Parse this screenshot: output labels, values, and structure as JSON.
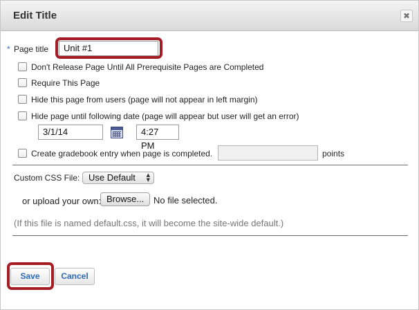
{
  "dialog": {
    "title": "Edit Title",
    "close_glyph": "✖"
  },
  "page_title": {
    "required_marker": "*",
    "label": "Page title",
    "value": "Unit #1"
  },
  "options": [
    {
      "label": "Don't Release Page Until All Prerequisite Pages are Completed",
      "checked": false
    },
    {
      "label": "Require This Page",
      "checked": false
    },
    {
      "label": "Hide this page from users (page will not appear in left margin)",
      "checked": false
    },
    {
      "label": "Hide page until following date (page will appear but user will get an error)",
      "checked": false
    }
  ],
  "release_date": {
    "date": "3/1/14",
    "time": "4:27 PM",
    "calendar_icon": "calendar-icon"
  },
  "gradebook": {
    "label": "Create gradebook entry when page is completed.",
    "value": "",
    "suffix": "points"
  },
  "css": {
    "label": "Custom CSS File:",
    "selected": "Use Default",
    "upload_label": "or upload your own:",
    "browse_label": "Browse...",
    "file_status": "No file selected.",
    "note": "(If this file is named default.css, it will become the site-wide default.)"
  },
  "actions": {
    "save_label": "Save",
    "cancel_label": "Cancel"
  },
  "colors": {
    "highlight": "#a51d24",
    "link_blue": "#2c6ab6",
    "required_blue": "#2a6fbf"
  }
}
